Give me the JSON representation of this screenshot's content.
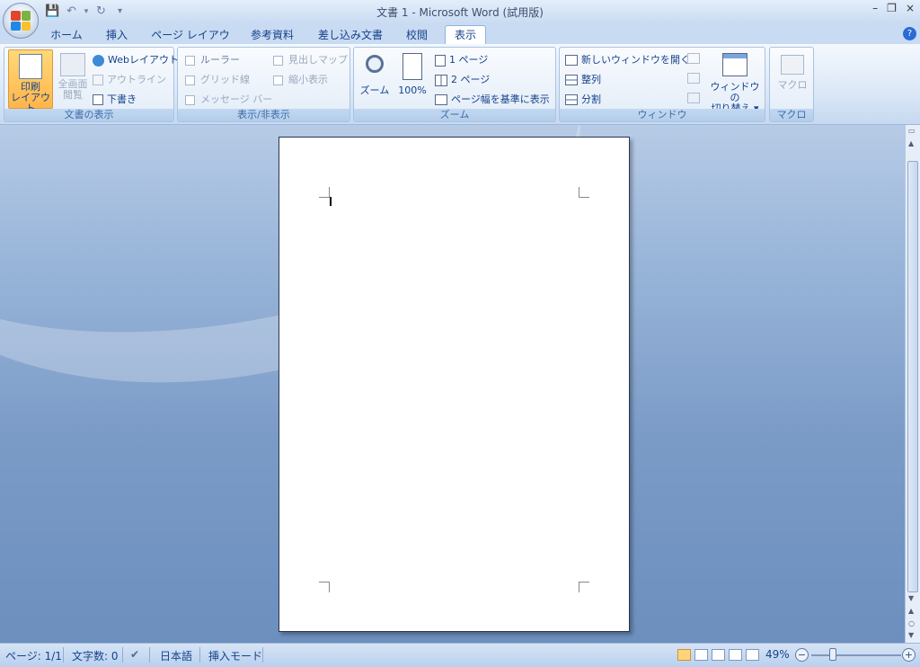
{
  "window": {
    "title": "文書 1 - Microsoft Word (試用版)",
    "minimize": "–",
    "restore": "❐",
    "close": "×"
  },
  "tabs": [
    {
      "label": "ホーム"
    },
    {
      "label": "挿入"
    },
    {
      "label": "ページ レイアウト"
    },
    {
      "label": "参考資料"
    },
    {
      "label": "差し込み文書"
    },
    {
      "label": "校閲"
    },
    {
      "label": "表示",
      "active": true
    }
  ],
  "help": "?",
  "groups": {
    "doc_view": {
      "label": "文書の表示",
      "print_layout": "印刷\nレイアウト",
      "print_layout_l1": "印刷",
      "print_layout_l2": "レイアウト",
      "fullscreen_l1": "全画面",
      "fullscreen_l2": "閲覧",
      "web_layout": "Webレイアウト",
      "outline": "アウトライン",
      "draft": "下書き"
    },
    "show_hide": {
      "label": "表示/非表示",
      "ruler": "ルーラー",
      "gridlines": "グリッド線",
      "message_bar": "メッセージ バー",
      "doc_map": "見出しマップ",
      "thumbnails": "縮小表示"
    },
    "zoom": {
      "label": "ズーム",
      "zoom": "ズーム",
      "hundred": "100%",
      "one_page": "1 ページ",
      "two_pages": "2 ページ",
      "page_width": "ページ幅を基準に表示"
    },
    "window": {
      "label": "ウィンドウ",
      "new_window": "新しいウィンドウを開く",
      "arrange": "整列",
      "split": "分割",
      "switch_l1": "ウィンドウの",
      "switch_l2": "切り替え ▾"
    },
    "macro": {
      "label": "マクロ",
      "macro": "マクロ"
    }
  },
  "status": {
    "page": "ページ: 1/1",
    "words": "文字数: 0",
    "language": "日本語",
    "mode": "挿入モード",
    "zoom": "49%"
  }
}
